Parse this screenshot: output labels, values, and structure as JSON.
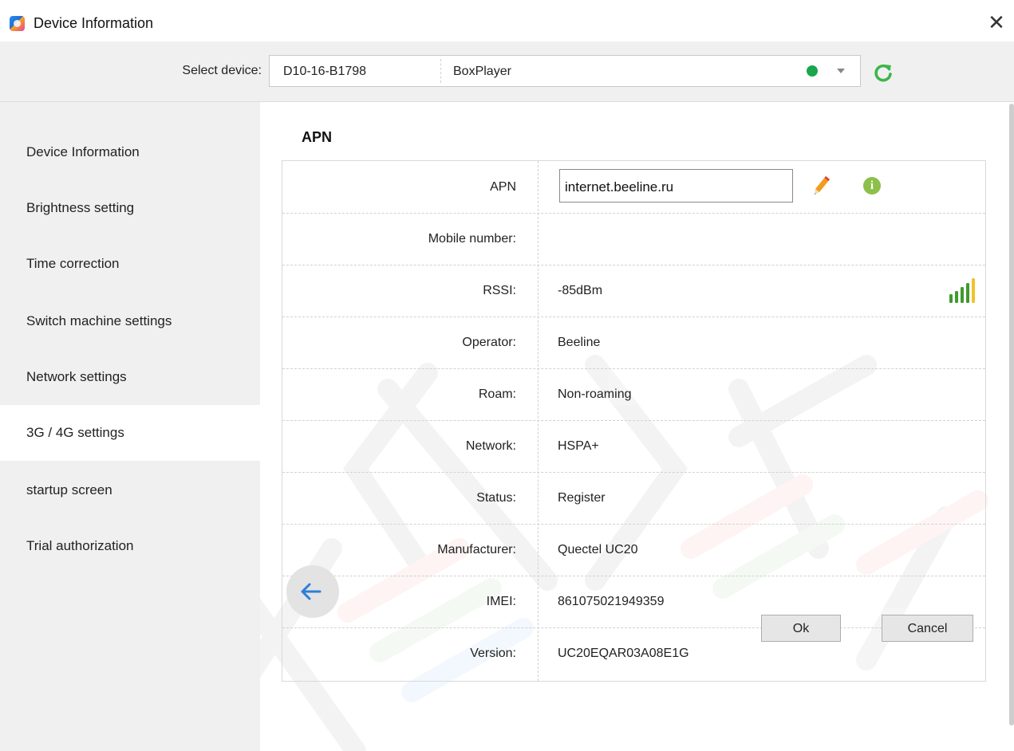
{
  "window": {
    "title": "Device Information",
    "close_symbol": "✕",
    "app_icon": "app-logo-icon"
  },
  "toolbar": {
    "select_label": "Select device:",
    "device_id": "D10-16-B1798",
    "device_name": "BoxPlayer",
    "status_color": "#1aa64a",
    "refresh_icon": "refresh-icon"
  },
  "sidebar": {
    "items": [
      {
        "label": "Device Information",
        "active": false
      },
      {
        "label": "Brightness setting",
        "active": false
      },
      {
        "label": "Time correction",
        "active": false
      },
      {
        "label": "Switch machine settings",
        "active": false
      },
      {
        "label": "Network settings",
        "active": false
      },
      {
        "label": "3G / 4G settings",
        "active": true
      },
      {
        "label": "startup screen",
        "active": false
      },
      {
        "label": "Trial authorization",
        "active": false
      }
    ]
  },
  "main": {
    "section_title": "APN",
    "rows": [
      {
        "label": "APN",
        "value": "internet.beeline.ru"
      },
      {
        "label": "Mobile number:",
        "value": ""
      },
      {
        "label": "RSSI:",
        "value": "-85dBm"
      },
      {
        "label": "Operator:",
        "value": "Beeline"
      },
      {
        "label": "Roam:",
        "value": "Non-roaming"
      },
      {
        "label": "Network:",
        "value": "HSPA+"
      },
      {
        "label": "Status:",
        "value": "Register"
      },
      {
        "label": "Manufacturer:",
        "value": "Quectel UC20"
      },
      {
        "label": "IMEI:",
        "value": "861075021949359"
      },
      {
        "label": "Version:",
        "value": "UC20EQAR03A08E1G"
      }
    ],
    "info_symbol": "i",
    "signal_bars_active": 4,
    "signal_bars_total": 5
  },
  "footer": {
    "ok_label": "Ok",
    "cancel_label": "Cancel"
  },
  "colors": {
    "accent_green": "#8cc04a",
    "refresh_green": "#3db54a",
    "signal_green": "#3f9a2f",
    "signal_yellow": "#f2c12e"
  }
}
